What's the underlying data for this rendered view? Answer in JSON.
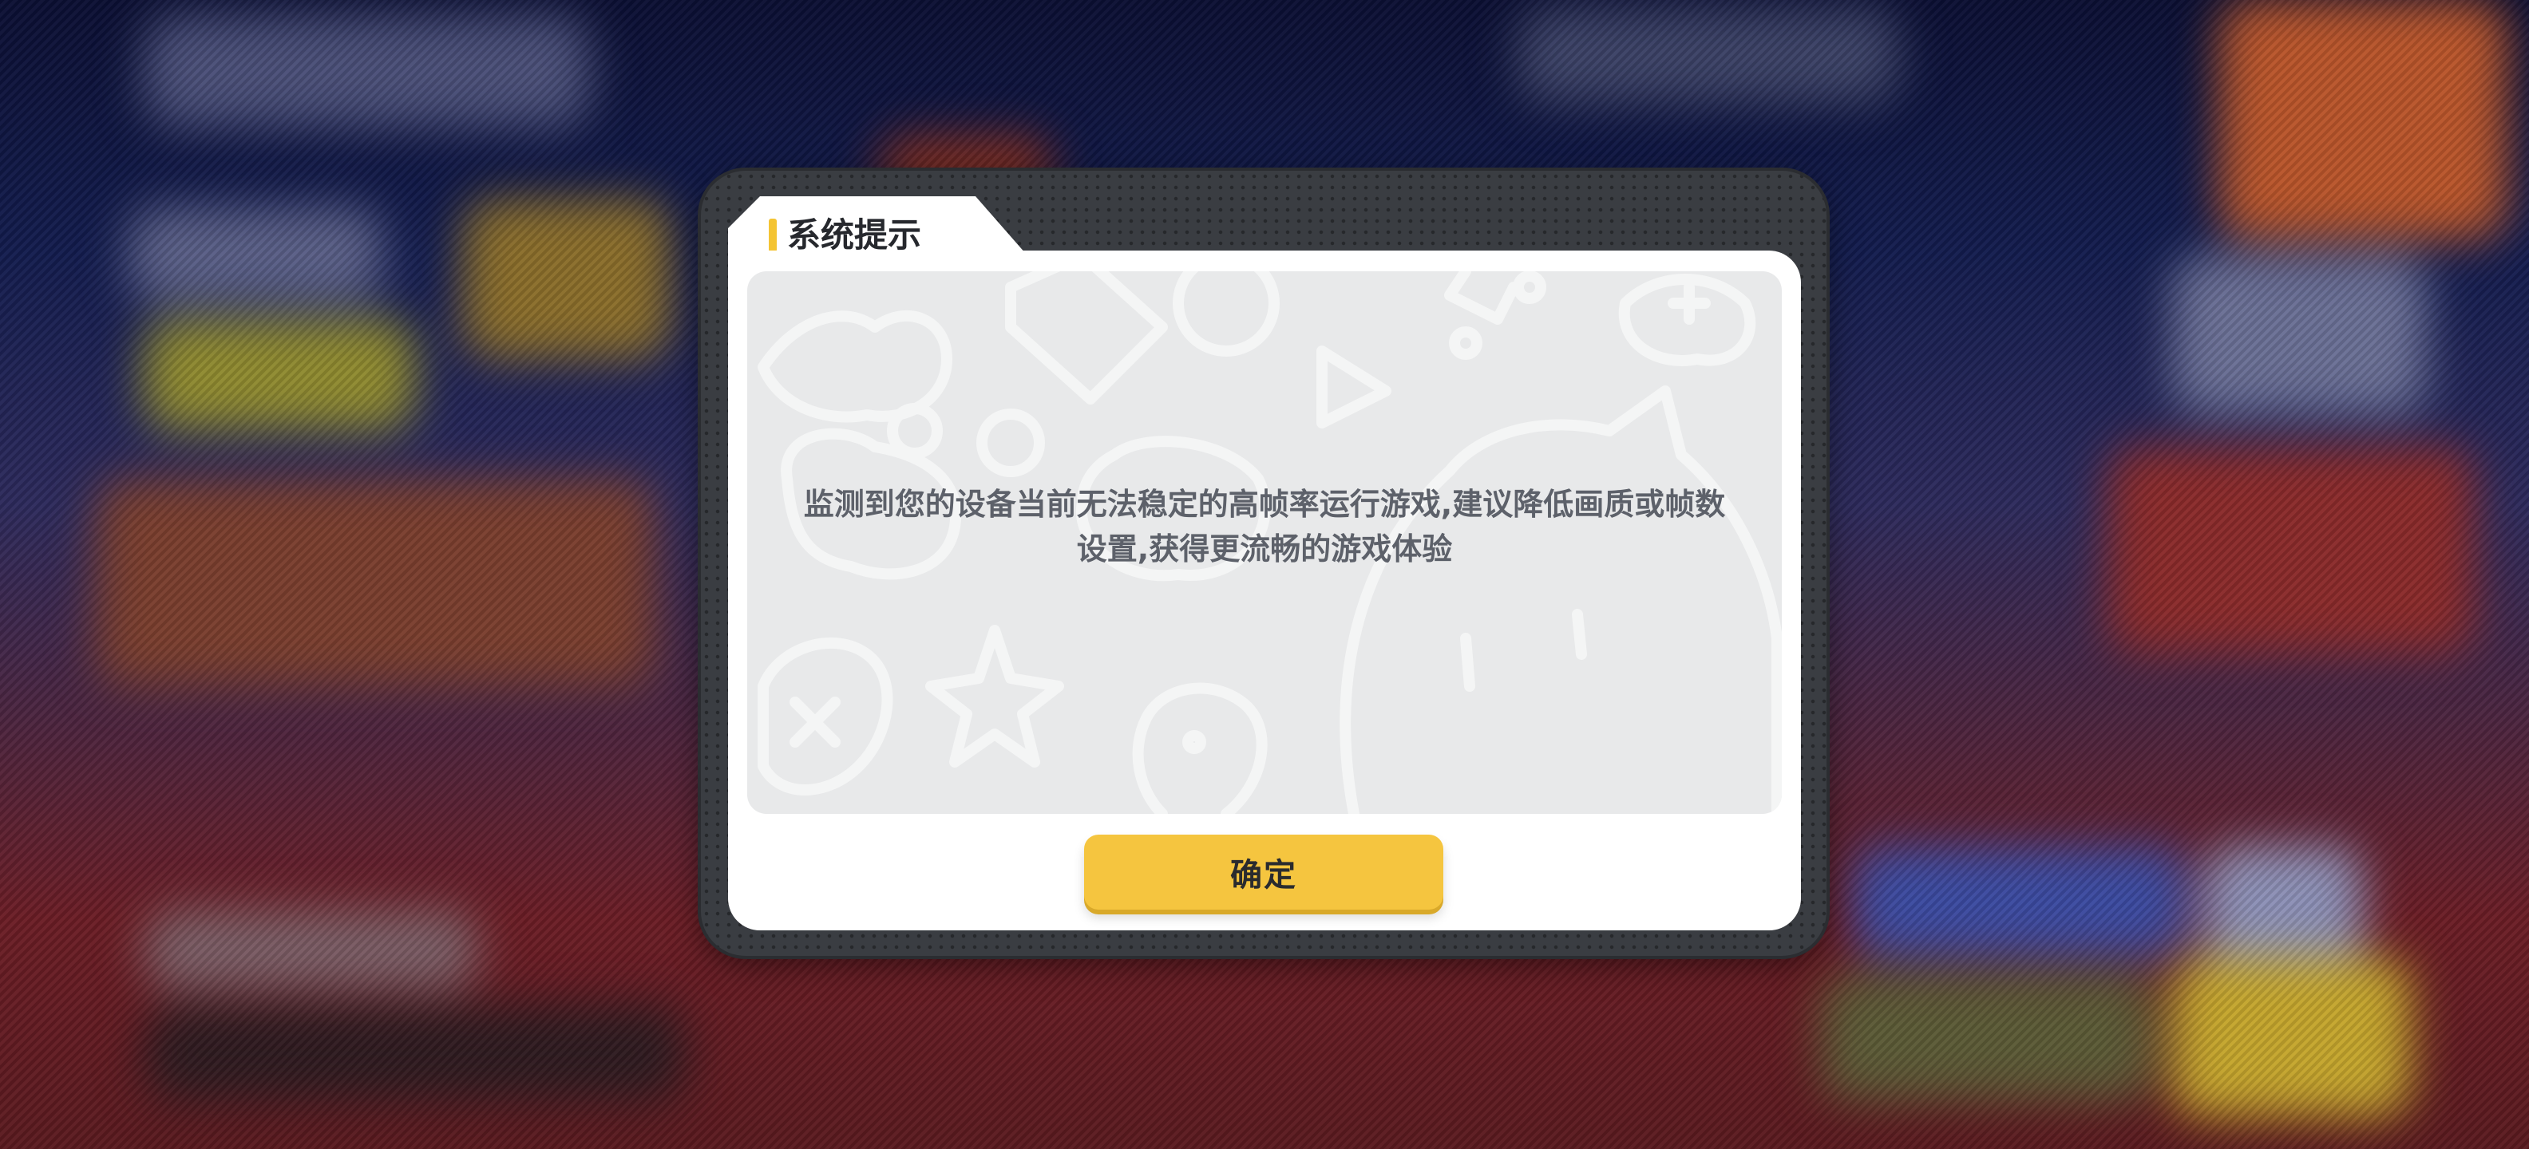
{
  "dialog": {
    "title": "系统提示",
    "message": "监测到您的设备当前无法稳定的高帧率运行游戏,建议降低画质或帧数设置,获得更流畅的游戏体验",
    "confirm_label": "确定"
  },
  "colors": {
    "accent": "#f4c433",
    "button": "#f5c53f",
    "frame": "#3a3d42",
    "message_text": "#5d616a",
    "title_text": "#26282d"
  },
  "icons": [
    "doodle-background-pattern"
  ]
}
